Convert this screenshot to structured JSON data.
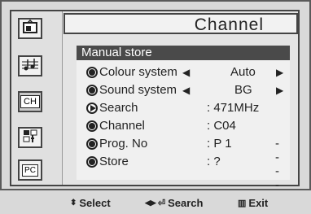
{
  "menu": {
    "title": "Channel",
    "header": "Manual store",
    "items": [
      {
        "label": "Colour system",
        "value": "Auto"
      },
      {
        "label": "Sound system",
        "value": "BG"
      },
      {
        "label": "Search",
        "value": ": 471MHz"
      },
      {
        "label": "Channel",
        "value": ": C04"
      },
      {
        "label": "Prog. No",
        "value": ": P 1",
        "extra": "-----"
      },
      {
        "label": "Store",
        "value": ": ?"
      }
    ]
  },
  "sidebar": {
    "items": [
      {
        "icon": "picture-icon"
      },
      {
        "icon": "sound-icon"
      },
      {
        "icon": "channel-icon",
        "label": "CH"
      },
      {
        "icon": "setup-icon"
      },
      {
        "icon": "pc-icon",
        "label": "PC"
      }
    ]
  },
  "footer": {
    "select": "Select",
    "search": "Search",
    "exit": "Exit"
  }
}
